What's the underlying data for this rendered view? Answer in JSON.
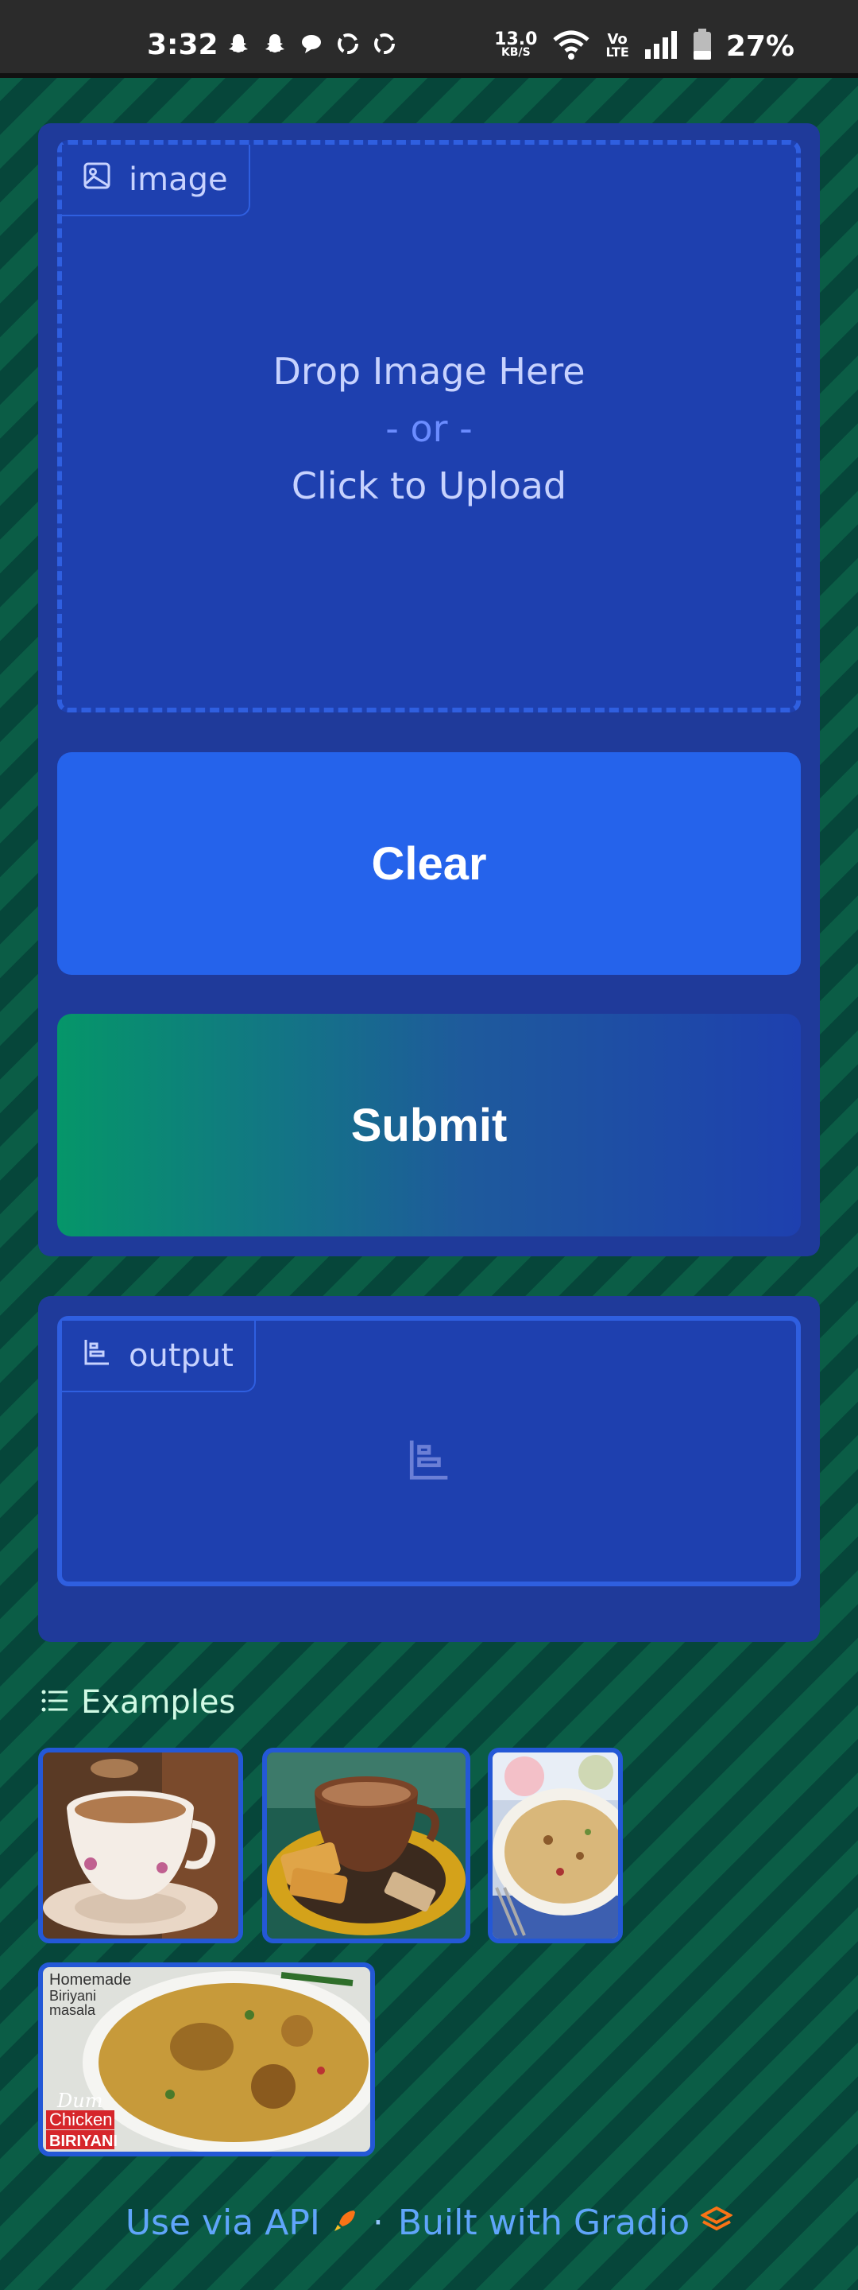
{
  "status_bar": {
    "time": "3:32",
    "net_speed_value": "13.0",
    "net_speed_unit": "KB/S",
    "volte_top": "Vo",
    "volte_bottom": "LTE",
    "battery_percent": "27%"
  },
  "input": {
    "label": "image",
    "drop_line1": "Drop Image Here",
    "drop_or": "- or -",
    "drop_line2": "Click to Upload"
  },
  "buttons": {
    "clear_label": "Clear",
    "submit_label": "Submit"
  },
  "output": {
    "label": "output"
  },
  "examples": {
    "label": "Examples",
    "thumb4_text1": "Homemade",
    "thumb4_text2": "Biriyani",
    "thumb4_text3": "masala",
    "thumb4_badge1": "Dum",
    "thumb4_badge2": "Chicken",
    "thumb4_badge3": "BIRIYANI"
  },
  "footer": {
    "api_label": "Use via API",
    "separator": "·",
    "built_label": "Built with Gradio"
  },
  "colors": {
    "panel": "#1f3a9a",
    "dropzone": "#1e40af",
    "clear_button": "#2563eb",
    "submit_gradient_start": "#059669",
    "footer_link": "#60a5fa"
  },
  "icons": {
    "image_label": "image-icon",
    "output_label": "bar-chart-icon",
    "examples": "list-icon",
    "api": "rocket-icon",
    "gradio": "gradio-logo-icon"
  }
}
